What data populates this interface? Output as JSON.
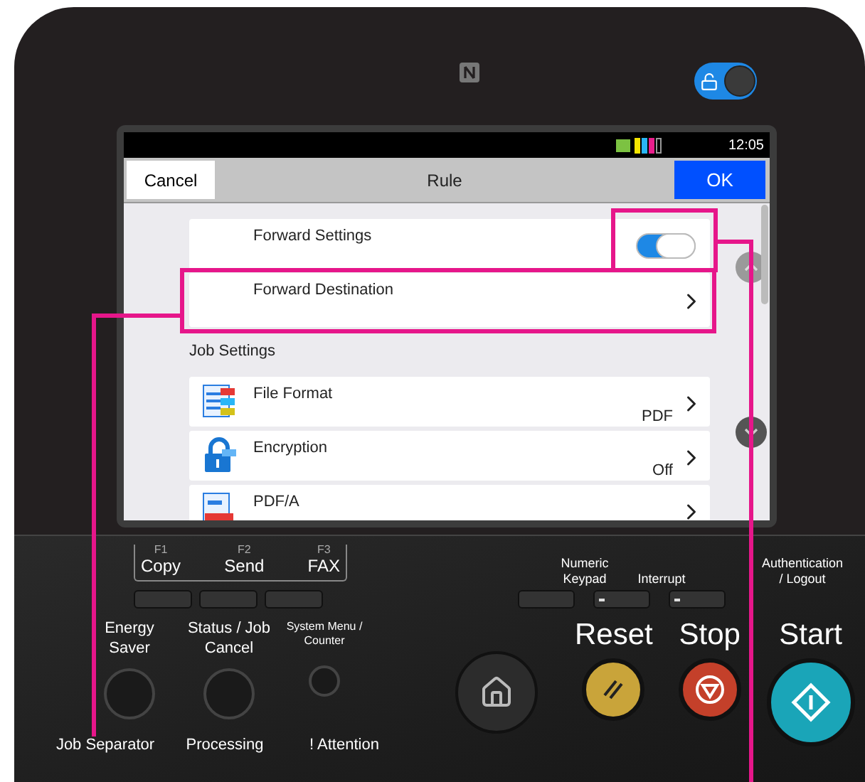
{
  "device": {
    "lock_toggle": {
      "on": true
    }
  },
  "screen": {
    "status_bar": {
      "time": "12:05"
    },
    "header": {
      "cancel": "Cancel",
      "title": "Rule",
      "ok": "OK"
    },
    "rows": [
      {
        "kind": "toggle",
        "label": "Forward Settings",
        "on": true,
        "highlighted": true
      },
      {
        "kind": "link",
        "label": "Forward Destination",
        "highlighted": true
      }
    ],
    "section_title": "Job Settings",
    "settings": [
      {
        "kind": "file-format",
        "label": "File Format",
        "value": "PDF"
      },
      {
        "kind": "encryption",
        "label": "Encryption",
        "value": "Off"
      },
      {
        "kind": "pdfa",
        "label": "PDF/A"
      }
    ]
  },
  "panel": {
    "function_keys": [
      {
        "key": "F1",
        "label": "Copy"
      },
      {
        "key": "F2",
        "label": "Send"
      },
      {
        "key": "F3",
        "label": "FAX"
      }
    ],
    "right_keys": [
      {
        "label": "Numeric Keypad",
        "led": false
      },
      {
        "label": "Interrupt",
        "led": true
      },
      {
        "label": "Authentication / Logout",
        "led": true
      }
    ],
    "round_buttons": [
      {
        "kind": "large",
        "label": "Energy Saver"
      },
      {
        "kind": "large",
        "label": "Status / Job Cancel"
      },
      {
        "kind": "small",
        "label": "System Menu / Counter"
      }
    ],
    "indicators": [
      "Job Separator",
      "Processing",
      "! Attention"
    ],
    "action_buttons": [
      {
        "kind": "reset",
        "label": "Reset"
      },
      {
        "kind": "stop",
        "label": "Stop"
      },
      {
        "kind": "start",
        "label": "Start"
      }
    ]
  }
}
